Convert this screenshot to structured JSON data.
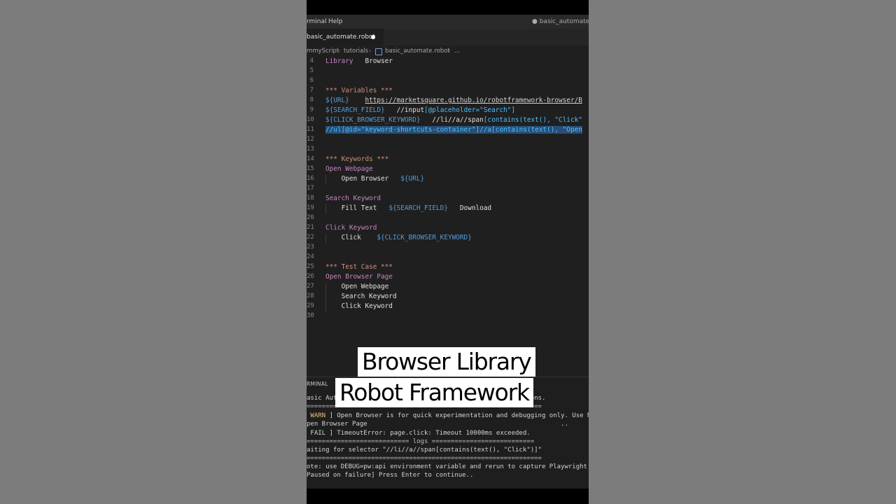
{
  "menubar": {
    "items": [
      "rminal",
      "Help"
    ],
    "right_title": "● basic_automate.rob"
  },
  "tab": {
    "label": "basic_automate.robot"
  },
  "breadcrumb": [
    "mmyScript",
    "tutorials",
    "basic_automate.robot",
    "..."
  ],
  "editor": {
    "lines": [
      {
        "n": "4",
        "parts": [
          [
            "kw-name",
            "Library"
          ],
          [
            "txt",
            "   Browser"
          ]
        ]
      },
      {
        "n": "5",
        "parts": []
      },
      {
        "n": "6",
        "parts": []
      },
      {
        "n": "7",
        "parts": [
          [
            "kw-head",
            "*** Variables ***"
          ]
        ]
      },
      {
        "n": "8",
        "parts": [
          [
            "var",
            "${URL}"
          ],
          [
            "txt",
            "    "
          ],
          [
            "under",
            "https://marketsquare.github.io/robotframework-browser/B"
          ]
        ]
      },
      {
        "n": "9",
        "parts": [
          [
            "var",
            "${SEARCH_FIELD}"
          ],
          [
            "txt",
            "   //input"
          ],
          [
            "loc",
            "[@placeholder=\"Search\"]"
          ]
        ]
      },
      {
        "n": "10",
        "parts": [
          [
            "var",
            "${CLICK_BROWSER_KEYWORD}"
          ],
          [
            "txt",
            "   //li//a//span"
          ],
          [
            "loc",
            "[contains(text(), \"Click\""
          ]
        ]
      },
      {
        "n": "11",
        "sel": true,
        "parts": [
          [
            "loc",
            "//ul[@id=\"keyword-shortcuts-container\"]//a[contains(text(), \"Open"
          ]
        ]
      },
      {
        "n": "12",
        "parts": []
      },
      {
        "n": "13",
        "parts": []
      },
      {
        "n": "14",
        "parts": [
          [
            "kw-head",
            "*** Keywords ***"
          ]
        ]
      },
      {
        "n": "15",
        "parts": [
          [
            "kw-name",
            "Open Webpage"
          ]
        ]
      },
      {
        "n": "16",
        "indent": true,
        "parts": [
          [
            "txt",
            "    Open Browser   "
          ],
          [
            "var",
            "${URL}"
          ]
        ]
      },
      {
        "n": "17",
        "parts": []
      },
      {
        "n": "18",
        "parts": [
          [
            "kw-name",
            "Search Keyword"
          ]
        ]
      },
      {
        "n": "19",
        "indent": true,
        "parts": [
          [
            "txt",
            "    Fill Text   "
          ],
          [
            "var",
            "${SEARCH_FIELD}"
          ],
          [
            "txt",
            "   Download"
          ]
        ]
      },
      {
        "n": "20",
        "parts": []
      },
      {
        "n": "21",
        "parts": [
          [
            "kw-name",
            "Click Keyword"
          ]
        ]
      },
      {
        "n": "22",
        "indent": true,
        "parts": [
          [
            "txt",
            "    Click    "
          ],
          [
            "var",
            "${CLICK_BROWSER_KEYWORD}"
          ]
        ]
      },
      {
        "n": "23",
        "parts": []
      },
      {
        "n": "24",
        "parts": []
      },
      {
        "n": "25",
        "parts": [
          [
            "kw-head",
            "*** Test Case ***"
          ]
        ]
      },
      {
        "n": "26",
        "parts": [
          [
            "kw-name",
            "Open Browser Page"
          ]
        ]
      },
      {
        "n": "27",
        "indent": true,
        "parts": [
          [
            "txt",
            "    Open Webpage"
          ]
        ]
      },
      {
        "n": "28",
        "indent": true,
        "parts": [
          [
            "txt",
            "    Search Keyword"
          ]
        ]
      },
      {
        "n": "29",
        "indent": true,
        "parts": [
          [
            "txt",
            "    Click Keyword"
          ]
        ]
      },
      {
        "n": "30",
        "parts": []
      }
    ]
  },
  "terminal": {
    "tab_label": "RMINAL",
    "lines": [
      {
        "cls": "",
        "text": "asic Aut                                             functions."
      },
      {
        "cls": "muted",
        "text": "=============================================================="
      },
      {
        "cls": "",
        "text": "",
        "warn": " WARN ",
        "rest": "] Open Browser is for quick experimentation and debugging only. Use Ne"
      },
      {
        "cls": "",
        "text": "pen Browser Page                                                   .."
      },
      {
        "cls": "",
        "text": " FAIL ] TimeoutError: page.click: Timeout 10000ms exceeded."
      },
      {
        "cls": "muted",
        "text": "=========================== logs ==========================="
      },
      {
        "cls": "",
        "text": "aiting for selector \"//li//a//span[contains(text(), \"Click\")]\""
      },
      {
        "cls": "muted",
        "text": "=============================================================="
      },
      {
        "cls": "",
        "text": "ote: use DEBUG=pw:api environment variable and rerun to capture Playwright l"
      },
      {
        "cls": "",
        "text": "Paused on failure] Press Enter to continue.."
      }
    ]
  },
  "caption": {
    "line1": "Browser Library",
    "line2": "Robot Framework"
  }
}
